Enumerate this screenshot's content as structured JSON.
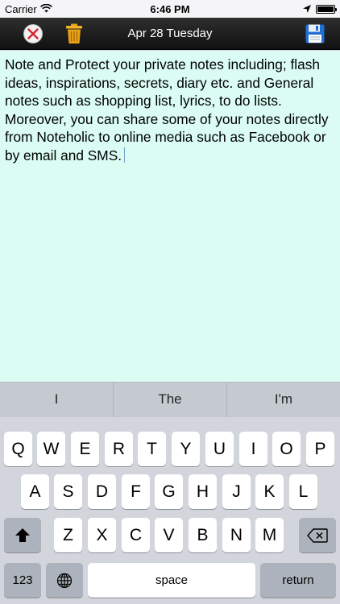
{
  "status_bar": {
    "carrier": "Carrier",
    "time": "6:46 PM",
    "icons": [
      "wifi-icon",
      "location-arrow-icon",
      "battery-icon"
    ],
    "battery_level": 1.0
  },
  "toolbar": {
    "date": "Apr 28 Tuesday",
    "icons": [
      "cancel-icon",
      "trash-icon",
      "save-floppy-icon"
    ]
  },
  "note": {
    "text": "Note and Protect your private notes including; flash ideas, inspirations, secrets, diary etc. and General notes such as shopping list, lyrics, to do lists. Moreover, you can share some of your notes directly from Noteholic to online media such as Facebook or by email and SMS."
  },
  "suggestions": [
    "I",
    "The",
    "I'm"
  ],
  "keyboard": {
    "row1": [
      "Q",
      "W",
      "E",
      "R",
      "T",
      "Y",
      "U",
      "I",
      "O",
      "P"
    ],
    "row2": [
      "A",
      "S",
      "D",
      "F",
      "G",
      "H",
      "J",
      "K",
      "L"
    ],
    "row3": [
      "Z",
      "X",
      "C",
      "V",
      "B",
      "N",
      "M"
    ],
    "numbers_label": "123",
    "space_label": "space",
    "return_label": "return",
    "icons": [
      "shift-icon",
      "backspace-icon",
      "globe-icon"
    ]
  },
  "colors": {
    "note_background": "#dafcf3",
    "toolbar_background": "#1c1c1c",
    "cancel_red": "#d8222b",
    "trash_orange": "#e8a317",
    "save_blue": "#1f6fd6"
  }
}
